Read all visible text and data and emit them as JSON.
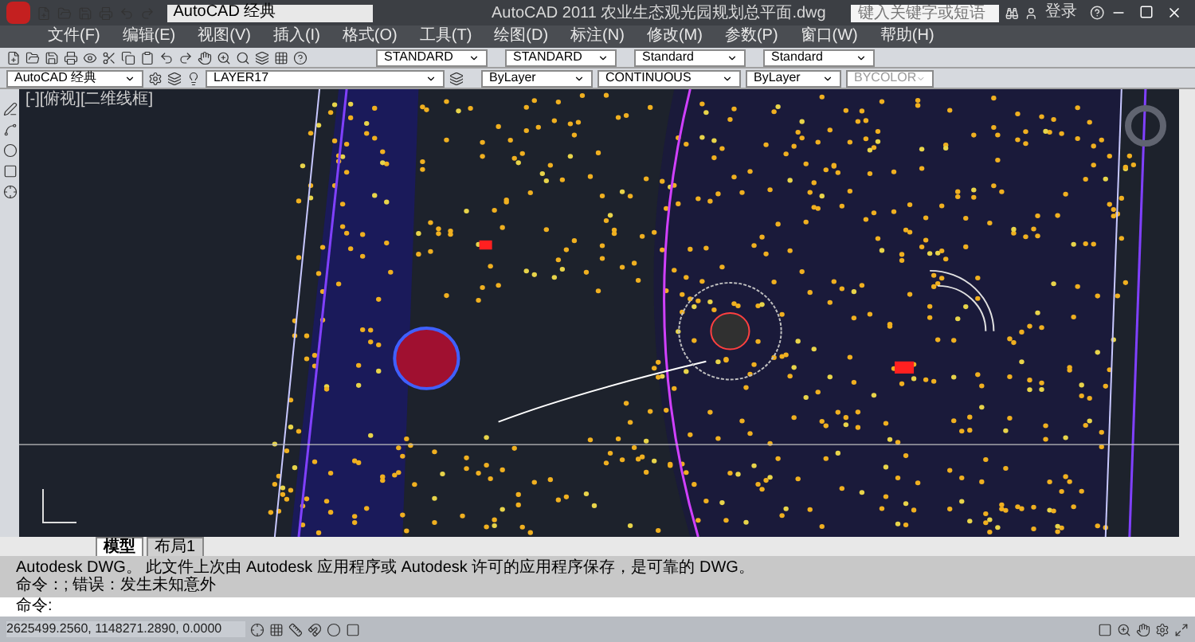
{
  "title_bar": {
    "workspace": "AutoCAD 经典",
    "title": "AutoCAD 2011  农业生态观光园规划总平面.dwg",
    "search": {
      "placeholder": "键入关键字或短语"
    },
    "login": "登录"
  },
  "menu": [
    "文件(F)",
    "编辑(E)",
    "视图(V)",
    "插入(I)",
    "格式(O)",
    "工具(T)",
    "绘图(D)",
    "标注(N)",
    "修改(M)",
    "参数(P)",
    "窗口(W)",
    "帮助(H)"
  ],
  "styles_bar": {
    "text_style": "STANDARD",
    "dim_style": "STANDARD",
    "table_style": "Standard",
    "multileader_style": "Standard"
  },
  "layers_bar": {
    "workspace": "AutoCAD 经典",
    "layer": "LAYER17",
    "color_control": "ByLayer",
    "linetype": "CONTINUOUS",
    "lineweight": "ByLayer",
    "plot_style": "BYCOLOR"
  },
  "viewport_label": "[-][俯视][二维线框]",
  "layout_tabs": [
    {
      "label": "模型",
      "selected": true
    },
    {
      "label": "布局1",
      "selected": false
    }
  ],
  "command_history": [
    "Autodesk DWG。  此文件上次由 Autodesk 应用程序或 Autodesk 许可的应用程序保存，是可靠的 DWG。",
    "命令：; 错误：发生未知意外"
  ],
  "command_prompt": "命令:",
  "coordinates": "2625499.2560, 1148271.2890, 0.0000"
}
